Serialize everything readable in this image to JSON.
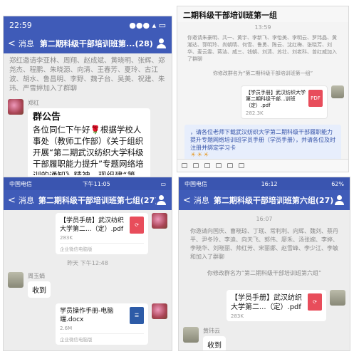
{
  "panel1": {
    "status": {
      "time": "22:59",
      "icons": "●●● ▴ ▭"
    },
    "nav": {
      "back": "消息",
      "title": "第二期科级干部培训班第...(28)"
    },
    "system_message": "郑红邀请李亚林、周翔、赵成斌、黄晓明、张辉、郑尧杰、程鹏、朱晓源、向清、王春芳、夏玲、古江波、胡水、鲁昌明、李野、魏子台、吴美、祝建、朱玮、严雪婷加入了群聊",
    "sender": "郑红",
    "notice_title": "群公告",
    "notice_body": "各位同仁下午好🌹根据学校人事处（教师工作部）《关于组织开展“第二期武汉纺织大学科级干部履职能力提升”专题网络培训的通知》精神，现组建“第"
  },
  "panel2": {
    "title": "二期科级干部培训班第一组",
    "time": "13:59",
    "system_message": "你邀请朱豪明、共一、黄宇、李新飞、李怡美、李明云、罗玮晶、黄潮达、郭明玲、尚朝晴、何雪、鲁勇、陈云、沈红梅、张晓芳、刘华、麦云雯、蒋洁、威三、钱朝、刘清、苏壮、刘老科、曾红威加入了群聊",
    "rename": "你修改群名为“第二期科级干部培训班第一组”",
    "file": {
      "name": "【学员手册】武汉纺织大学第二期科级干部...训班（定）.pdf",
      "size": "282.3K",
      "type": "PDF"
    },
    "blue_message": "，请各位老师下载武汉纺织大学第二期科级干部履职能力提升专题网络培训班学员手册（学员手册），并请各位及时注册并绑定学习卡",
    "emoji": "☀☀☀"
  },
  "panel3": {
    "status": {
      "carrier": "中国电信",
      "time": "下午11:05",
      "battery": "▭"
    },
    "nav": {
      "back": "消息",
      "title": "第二期科级干部培训班第七组(27)"
    },
    "file1": {
      "name": "【学员手册】武汉纺织大学第二...（定）.pdf",
      "size": "283K",
      "source": "企业微信电脑版"
    },
    "time": "昨天 下午12:48",
    "sender": "周玉娟",
    "reply": "收到",
    "file2": {
      "name": "学员操作手册-电脑端.docx",
      "size": "2.6M",
      "source": "企业微信电脑版"
    }
  },
  "panel4": {
    "status": {
      "carrier": "中国电信",
      "time": "16:12",
      "battery": "62%"
    },
    "nav": {
      "back": "消息",
      "title": "第二期科级干部培训班第六组(27)"
    },
    "time": "16:07",
    "system_message": "你邀请向国庆、曹晓琼、丁珉、常利利、向辉、魏刘、蔡丹平、尹冬玲、李迪、向天飞、郭伟、廖禾、汤张婉、李婷、李晓华、刘晓丽、帅红芳、宋丽娜、赵雪峰、李少江、李敏和加入了群聊",
    "rename": "你修改群名为“第二期科级干部培训班第六组”",
    "file": {
      "name": "【学员手册】武汉纺织大学第二...（定）.pdf",
      "size": "283K"
    },
    "sender": "黄玮云",
    "reply": "收到"
  }
}
